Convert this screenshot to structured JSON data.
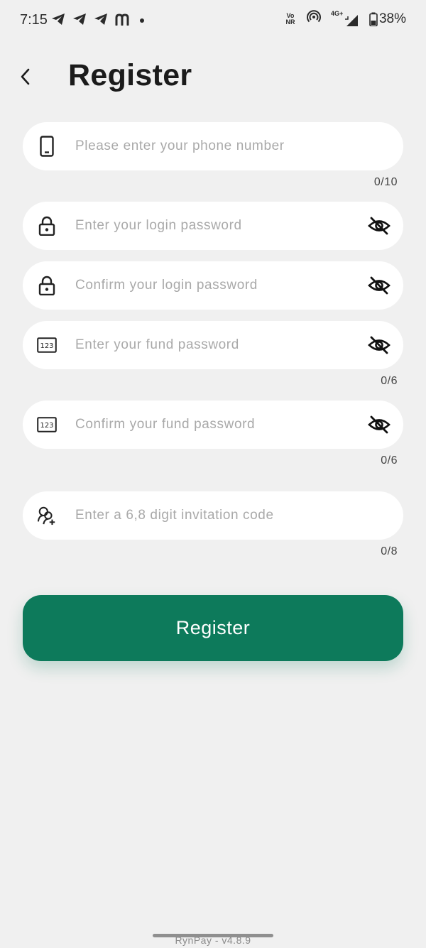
{
  "status_bar": {
    "time": "7:15",
    "left_icons": [
      "telegram-icon",
      "telegram-icon",
      "telegram-icon",
      "m-app-icon",
      "dot-icon"
    ],
    "volte_top": "Vo",
    "volte_bottom": "NR",
    "network_label": "4G+",
    "battery_percent": "38%"
  },
  "header": {
    "title": "Register"
  },
  "form": {
    "phone": {
      "placeholder": "Please enter your phone number",
      "counter": "0/10",
      "icon": "phone-icon"
    },
    "login_password": {
      "placeholder": "Enter your login password",
      "icon": "lock-icon"
    },
    "confirm_login_password": {
      "placeholder": "Confirm your login password",
      "icon": "lock-icon"
    },
    "fund_password": {
      "placeholder": "Enter your fund password",
      "counter": "0/6",
      "icon": "numeric-keypad-icon",
      "icon_text": "123"
    },
    "confirm_fund_password": {
      "placeholder": "Confirm your fund password",
      "counter": "0/6",
      "icon": "numeric-keypad-icon",
      "icon_text": "123"
    },
    "invitation_code": {
      "placeholder": "Enter a 6,8 digit invitation code",
      "counter": "0/8",
      "icon": "add-user-icon"
    }
  },
  "register_button": {
    "label": "Register"
  },
  "footer": {
    "version": "RynPay - v4.8.9"
  },
  "colors": {
    "background": "#f0f0f0",
    "field_background": "#ffffff",
    "primary": "#0d7a5b",
    "placeholder": "#a9a9a9",
    "text": "#1b1b1b"
  }
}
